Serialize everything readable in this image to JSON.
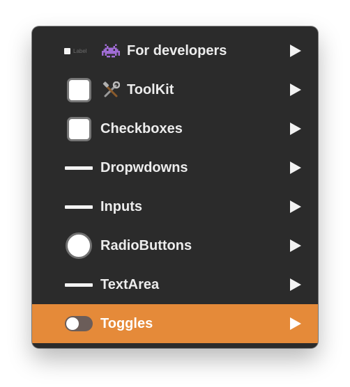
{
  "menu": {
    "items": [
      {
        "label": "For developers",
        "mini_label": "Label",
        "emoji": "👾",
        "icon": "mini-checkbox"
      },
      {
        "label": "ToolKit",
        "emoji": "🛠️",
        "icon": "checkbox"
      },
      {
        "label": "Checkboxes",
        "icon": "checkbox"
      },
      {
        "label": "Dropwdowns",
        "icon": "dropdown-line"
      },
      {
        "label": "Inputs",
        "icon": "input-line"
      },
      {
        "label": "RadioButtons",
        "icon": "radio-button"
      },
      {
        "label": "TextArea",
        "icon": "textarea-line"
      },
      {
        "label": "Toggles",
        "icon": "toggle",
        "highlighted": true
      }
    ],
    "submenu_indicator": "▶"
  },
  "colors": {
    "menu_background": "#2b2b2b",
    "highlight": "#e58a39",
    "text": "#ececec"
  }
}
